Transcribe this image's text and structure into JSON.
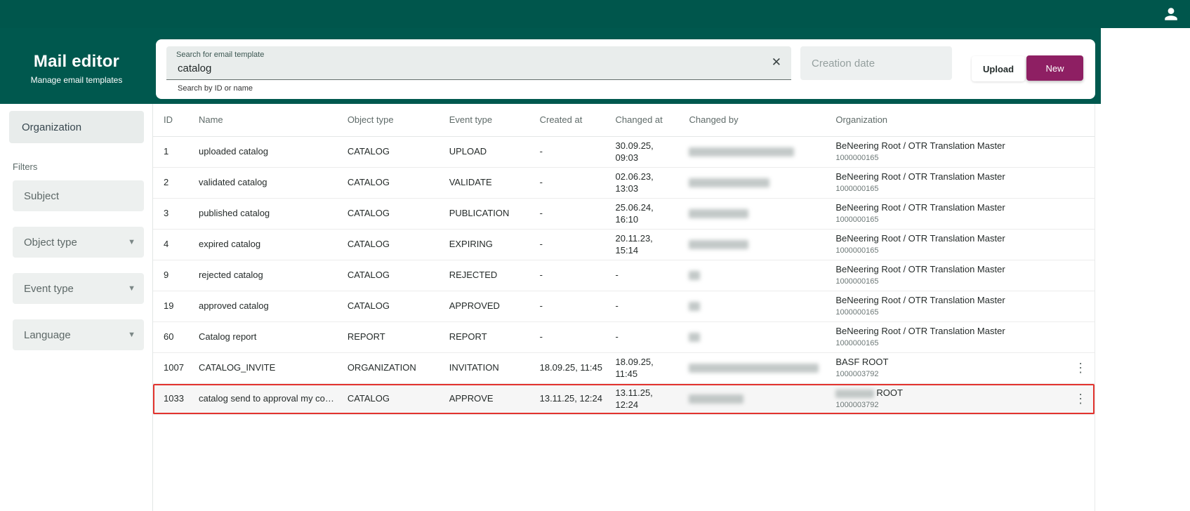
{
  "colors": {
    "teal_bar": "#00564c",
    "teal_header": "#00584e",
    "accent_button": "#8e1f63",
    "highlight_border": "#e2332e"
  },
  "topbar": {
    "user_icon": "person-icon"
  },
  "sidebar": {
    "title": "Mail editor",
    "subtitle": "Manage email templates",
    "org_tab_label": "Organization",
    "filters_label": "Filters",
    "filters": [
      {
        "label": "Subject",
        "dropdown": false
      },
      {
        "label": "Object type",
        "dropdown": true
      },
      {
        "label": "Event type",
        "dropdown": true
      },
      {
        "label": "Language",
        "dropdown": true
      }
    ]
  },
  "toolbar": {
    "search": {
      "label": "Search for email template",
      "value": "catalog",
      "helper": "Search by ID or name",
      "clear_icon": "✕"
    },
    "creation_date": {
      "placeholder": "Creation date"
    },
    "upload_label": "Upload",
    "new_label": "New"
  },
  "table": {
    "columns": [
      "ID",
      "Name",
      "Object type",
      "Event type",
      "Created at",
      "Changed at",
      "Changed by",
      "Organization"
    ],
    "rows": [
      {
        "id": "1",
        "name": "uploaded catalog",
        "object_type": "CATALOG",
        "event_type": "UPLOAD",
        "created_at": "-",
        "changed_at": "30.09.25, 09:03",
        "changed_by_redacted": true,
        "changed_by_blur_w": 150,
        "org": "BeNeering Root / OTR Translation Master",
        "org_id": "1000000165",
        "menu": false,
        "highlighted": false
      },
      {
        "id": "2",
        "name": "validated catalog",
        "object_type": "CATALOG",
        "event_type": "VALIDATE",
        "created_at": "-",
        "changed_at": "02.06.23, 13:03",
        "changed_by_redacted": true,
        "changed_by_blur_w": 115,
        "org": "BeNeering Root / OTR Translation Master",
        "org_id": "1000000165",
        "menu": false,
        "highlighted": false
      },
      {
        "id": "3",
        "name": "published catalog",
        "object_type": "CATALOG",
        "event_type": "PUBLICATION",
        "created_at": "-",
        "changed_at": "25.06.24, 16:10",
        "changed_by_redacted": true,
        "changed_by_blur_w": 85,
        "org": "BeNeering Root / OTR Translation Master",
        "org_id": "1000000165",
        "menu": false,
        "highlighted": false
      },
      {
        "id": "4",
        "name": "expired catalog",
        "object_type": "CATALOG",
        "event_type": "EXPIRING",
        "created_at": "-",
        "changed_at": "20.11.23, 15:14",
        "changed_by_redacted": true,
        "changed_by_blur_w": 85,
        "org": "BeNeering Root / OTR Translation Master",
        "org_id": "1000000165",
        "menu": false,
        "highlighted": false
      },
      {
        "id": "9",
        "name": "rejected catalog",
        "object_type": "CATALOG",
        "event_type": "REJECTED",
        "created_at": "-",
        "changed_at": "-",
        "changed_by_redacted": true,
        "changed_by_blur_w": 16,
        "org": "BeNeering Root / OTR Translation Master",
        "org_id": "1000000165",
        "menu": false,
        "highlighted": false
      },
      {
        "id": "19",
        "name": "approved catalog",
        "object_type": "CATALOG",
        "event_type": "APPROVED",
        "created_at": "-",
        "changed_at": "-",
        "changed_by_redacted": true,
        "changed_by_blur_w": 16,
        "org": "BeNeering Root / OTR Translation Master",
        "org_id": "1000000165",
        "menu": false,
        "highlighted": false
      },
      {
        "id": "60",
        "name": "Catalog report",
        "object_type": "REPORT",
        "event_type": "REPORT",
        "created_at": "-",
        "changed_at": "-",
        "changed_by_redacted": true,
        "changed_by_blur_w": 16,
        "org": "BeNeering Root / OTR Translation Master",
        "org_id": "1000000165",
        "menu": false,
        "highlighted": false
      },
      {
        "id": "1007",
        "name": "CATALOG_INVITE",
        "object_type": "ORGANIZATION",
        "event_type": "INVITATION",
        "created_at": "18.09.25, 11:45",
        "changed_at": "18.09.25, 11:45",
        "changed_by_redacted": true,
        "changed_by_blur_w": 185,
        "org": "BASF ROOT",
        "org_id": "1000003792",
        "menu": true,
        "highlighted": false
      },
      {
        "id": "1033",
        "name": "catalog send to approval my co…",
        "object_type": "CATALOG",
        "event_type": "APPROVE",
        "created_at": "13.11.25, 12:24",
        "changed_at": "13.11.25, 12:24",
        "changed_by_redacted": true,
        "changed_by_blur_w": 78,
        "org": "ROOT",
        "org_prefix_redacted": true,
        "org_id": "1000003792",
        "menu": true,
        "highlighted": true
      }
    ]
  }
}
